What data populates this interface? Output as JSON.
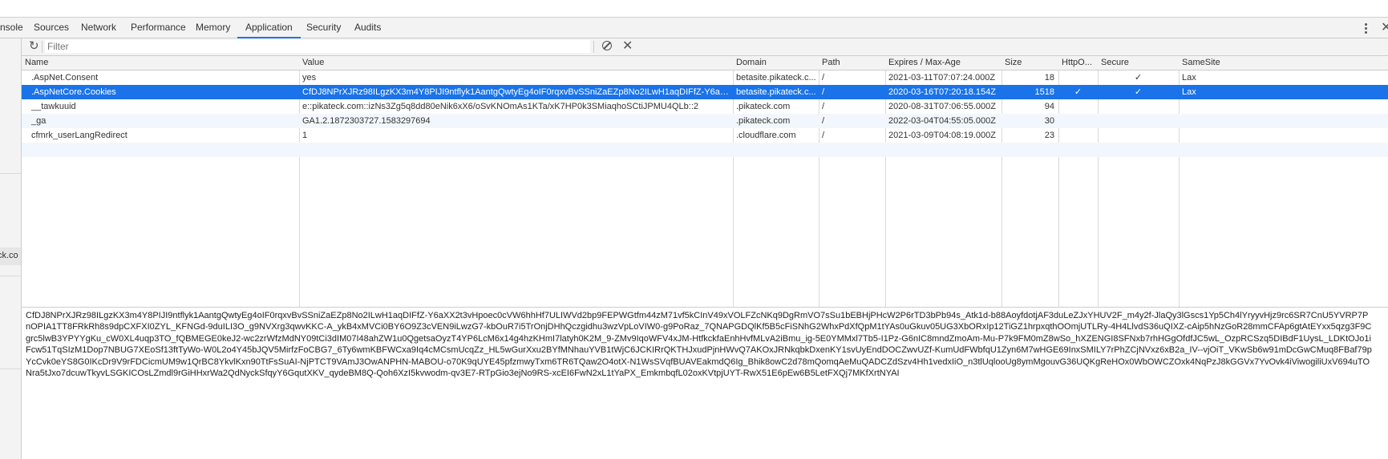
{
  "tabs": [
    {
      "label": "nsole"
    },
    {
      "label": "Sources"
    },
    {
      "label": "Network"
    },
    {
      "label": "Performance"
    },
    {
      "label": "Memory"
    },
    {
      "label": "Application"
    },
    {
      "label": "Security"
    },
    {
      "label": "Audits"
    }
  ],
  "active_tab": "Application",
  "left_panel": {
    "selected_item_partial": "ck.co"
  },
  "toolbar": {
    "filter_placeholder": "Filter"
  },
  "columns": [
    "Name",
    "Value",
    "Domain",
    "Path",
    "Expires / Max-Age",
    "Size",
    "HttpO...",
    "Secure",
    "SameSite"
  ],
  "cookies": [
    {
      "name": ".AspNet.Consent",
      "value": "yes",
      "domain": "betasite.pikateck.c...",
      "path": "/",
      "expires": "2021-03-11T07:07:24.000Z",
      "size": "18",
      "httponly": "",
      "secure": "✓",
      "samesite": "Lax"
    },
    {
      "name": ".AspNetCore.Cookies",
      "value": "CfDJ8NPrXJRz98ILgzKX3m4Y8PIJI9ntflyk1AantgQwtyEg4oIF0rqxvBvSSniZaEZp8No2ILwH1aqDIFfZ-Y6aXX2t3v...",
      "domain": "betasite.pikateck.c...",
      "path": "/",
      "expires": "2020-03-16T07:20:18.154Z",
      "size": "1518",
      "httponly": "✓",
      "secure": "✓",
      "samesite": "Lax"
    },
    {
      "name": "__tawkuuid",
      "value": "e::pikateck.com::izNs3Zg5q8dd80eNik6xX6/oSvKNOmAs1KTa/xK7HP0k3SMiaqhoSCtiJPMU4QLb::2",
      "domain": ".pikateck.com",
      "path": "/",
      "expires": "2020-08-31T07:06:55.000Z",
      "size": "94",
      "httponly": "",
      "secure": "",
      "samesite": ""
    },
    {
      "name": "_ga",
      "value": "GA1.2.1872303727.1583297694",
      "domain": ".pikateck.com",
      "path": "/",
      "expires": "2022-03-04T04:55:05.000Z",
      "size": "30",
      "httponly": "",
      "secure": "",
      "samesite": ""
    },
    {
      "name": "cfmrk_userLangRedirect",
      "value": "1",
      "domain": ".cloudflare.com",
      "path": "/",
      "expires": "2021-03-09T04:08:19.000Z",
      "size": "23",
      "httponly": "",
      "secure": "",
      "samesite": ""
    }
  ],
  "selected_row_index": 1,
  "preview_value": "CfDJ8NPrXJRz98ILgzKX3m4Y8PIJI9ntflyk1AantgQwtyEg4oIF0rqxvBvSSniZaEZp8No2ILwH1aqDIFfZ-Y6aXX2t3vHpoec0cVW6hhHf7ULIWVd2bp9FEPWGtfm44zM71vf5kCInV49xVOLFZcNKq9DgRmVO7sSu1bEBHjPHcW2P6rTD3bPb94s_Atk1d-b88AoyfdotjAF3duLeZJxYHUV2F_m4y2f-JlaQy3lGscs1Yp5Ch4lYryyvHjz9rc6SR7CnU5YVRP7PnOPIA1TT8FRkRh8s9dpCXFXI0ZYL_KFNGd-9duILI3O_g9NVXrg3qwvKKC-A_ykB4xMVCi0BY6O9Z3cVEN9iLwzG7-kbOuR7i5TrOnjDHhQczgidhu3wzVpLoVIW0-g9PoRaz_7QNAPGDQlKf5B5cFiSNhG2WhxPdXfQpM1tYAs0uGkuv05UG3XbORxIp12TiGZ1hrpxqthOOmjUTLRy-4H4LlvdS36uQIXZ-cAip5hNzGoR28mmCFAp6gtAtEYxx5qzg3F9Cgrc5lwB3YPYYgKu_cW0XL4uqp3TO_fQBMEGE0keJ2-wc2zrWfzMdNY09tCi3dIM07I48ahZW1u0QgetsaOyzT4YP6LcM6x14g4hzKHmI7latyh0K2M_9-ZMv9IqoWFV4xJM-HtfkckfaEnhHvfMLvA2iBmu_ig-5E0YMMxl7Tb5-I1Pz-G6nIC8mndZmoAm-Mu-P7k9FM0mZ8wSo_hXZENGI8SFNxb7rhHGgOfdfJC5wL_OzpRCSzq5DIBdF1UysL_LDKtOJo1iFcw51TqSIzM1Dop7NBUG7XEoSf13ftTyWo-W0L2o4Y45bJQV5MirfzFoCBG7_6Ty6wmKBFWCxa9Iq4cMCsmUcqZz_HL5wGurXxu2BYfMNhauYVB1tWjC6JCKIRrQKTHJxudPjnHWvQ7AKOxJRNkqbkDxenKY1svUyEndDOCZwvUZf-KumUdFWbfqU1Zyn6M7wHGE69InxSMILY7rPhZCjNVxz6xB2a_IV--vjOiT_VKwSb6w91mDcGwCMuq8FBaf79pYcCvk0eYS8G0IKcDr9V9rFDCicmUM9w1QrBC8YkvlKxn90TtFsSuAI-NjPTCT9VAmJ3OwANPHN-MABOU-o70K9qUYE45pfzmwyTxm6TR6TQaw2O4otX-N1WsSVqfBUAVEakmdQ6Ig_Bhik8owC2d78mQomqAeMuQADCZdSzv4Hh1vedxIiO_n3tlUqlooUg8ymMgouvG36UQKgReHOx0WbOWCZOxk4NqPzJ8kGGVx7YvOvk4iViwogiliUxV694uTONra5tJxo7dcuwTkyvLSGKICOsLZmdl9rGiHHxrWa2QdNyckSfqyY6GqutXKV_qydeBM8Q-Qoh6XzI5kvwodm-qv3E7-RTpGio3ejNo9RS-xcEI6FwN2xL1tYaPX_EmkmbqfL02oxKVtpjUYT-RwX51E6pEw6B5LetFXQj7MKfXrtNYAI"
}
